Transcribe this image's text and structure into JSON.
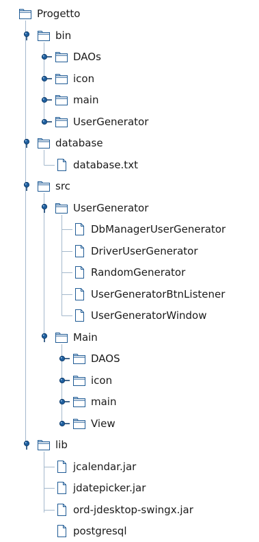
{
  "tree": {
    "nodes": [
      {
        "label": "Progetto",
        "type": "folder",
        "level": 0,
        "expanded": true,
        "handle": false,
        "icon": "folder-icon"
      },
      {
        "label": "bin",
        "type": "folder",
        "level": 1,
        "expanded": true,
        "handle": true,
        "icon": "folder-icon"
      },
      {
        "label": "DAOs",
        "type": "folder",
        "level": 2,
        "expanded": false,
        "handle": true,
        "icon": "folder-icon"
      },
      {
        "label": "icon",
        "type": "folder",
        "level": 2,
        "expanded": false,
        "handle": true,
        "icon": "folder-icon"
      },
      {
        "label": "main",
        "type": "folder",
        "level": 2,
        "expanded": false,
        "handle": true,
        "icon": "folder-icon"
      },
      {
        "label": "UserGenerator",
        "type": "folder",
        "level": 2,
        "expanded": false,
        "handle": true,
        "icon": "folder-icon"
      },
      {
        "label": "database",
        "type": "folder",
        "level": 1,
        "expanded": true,
        "handle": true,
        "icon": "folder-icon"
      },
      {
        "label": "database.txt",
        "type": "file",
        "level": 2,
        "expanded": false,
        "handle": false,
        "icon": "file-icon"
      },
      {
        "label": "src",
        "type": "folder",
        "level": 1,
        "expanded": true,
        "handle": true,
        "icon": "folder-icon"
      },
      {
        "label": "UserGenerator",
        "type": "folder",
        "level": 2,
        "expanded": true,
        "handle": true,
        "icon": "folder-icon"
      },
      {
        "label": "DbManagerUserGenerator",
        "type": "file",
        "level": 3,
        "expanded": false,
        "handle": false,
        "icon": "file-icon"
      },
      {
        "label": "DriverUserGenerator",
        "type": "file",
        "level": 3,
        "expanded": false,
        "handle": false,
        "icon": "file-icon"
      },
      {
        "label": "RandomGenerator",
        "type": "file",
        "level": 3,
        "expanded": false,
        "handle": false,
        "icon": "file-icon"
      },
      {
        "label": "UserGeneratorBtnListener",
        "type": "file",
        "level": 3,
        "expanded": false,
        "handle": false,
        "icon": "file-icon"
      },
      {
        "label": "UserGeneratorWindow",
        "type": "file",
        "level": 3,
        "expanded": false,
        "handle": false,
        "icon": "file-icon"
      },
      {
        "label": "Main",
        "type": "folder",
        "level": 2,
        "expanded": true,
        "handle": true,
        "icon": "folder-icon"
      },
      {
        "label": "DAOS",
        "type": "folder",
        "level": 3,
        "expanded": false,
        "handle": true,
        "icon": "folder-icon"
      },
      {
        "label": "icon",
        "type": "folder",
        "level": 3,
        "expanded": false,
        "handle": true,
        "icon": "folder-icon"
      },
      {
        "label": "main",
        "type": "folder",
        "level": 3,
        "expanded": false,
        "handle": true,
        "icon": "folder-icon"
      },
      {
        "label": "View",
        "type": "folder",
        "level": 3,
        "expanded": false,
        "handle": true,
        "icon": "folder-icon"
      },
      {
        "label": "lib",
        "type": "folder",
        "level": 1,
        "expanded": true,
        "handle": true,
        "icon": "folder-icon"
      },
      {
        "label": "jcalendar.jar",
        "type": "file",
        "level": 2,
        "expanded": false,
        "handle": false,
        "icon": "file-icon"
      },
      {
        "label": "jdatepicker.jar",
        "type": "file",
        "level": 2,
        "expanded": false,
        "handle": false,
        "icon": "file-icon"
      },
      {
        "label": "ord-jdesktop-swingx.jar",
        "type": "file",
        "level": 2,
        "expanded": false,
        "handle": false,
        "icon": "file-icon"
      },
      {
        "label": "postgresql",
        "type": "file",
        "level": 2,
        "expanded": false,
        "handle": false,
        "icon": "file-icon"
      }
    ]
  },
  "colors": {
    "guide": "#a3b8cc",
    "handle_fill": "#1f5f9e",
    "handle_stroke": "#123f6e",
    "icon_stroke": "#1e5a94",
    "icon_fill": "#ffffff",
    "icon_tab": "#d9e6f2",
    "text": "#1a1a1a"
  }
}
